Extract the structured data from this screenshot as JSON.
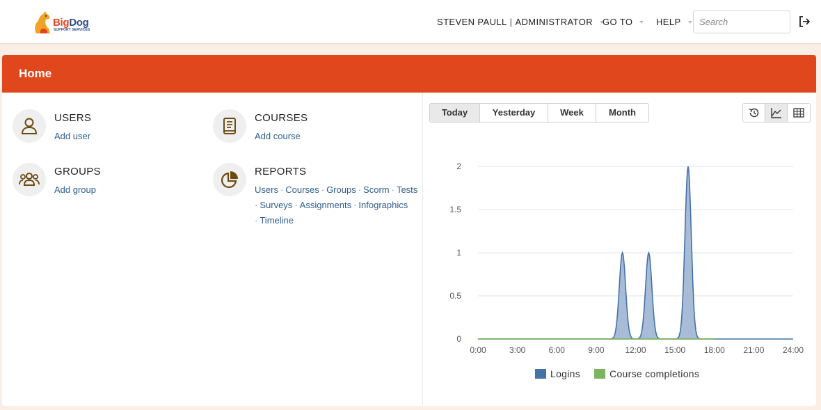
{
  "brand": {
    "name_part1": "Big",
    "name_part2": "Dog",
    "subtitle": "SUPPORT SERVICES"
  },
  "nav": {
    "user_name": "STEVEN PAULL",
    "separator": "|",
    "role": "ADMINISTRATOR",
    "goto_label": "GO TO",
    "help_label": "HELP",
    "search_placeholder": "Search"
  },
  "page": {
    "title": "Home"
  },
  "tiles": {
    "users": {
      "title": "USERS",
      "link": "Add user"
    },
    "courses": {
      "title": "COURSES",
      "link": "Add course"
    },
    "groups": {
      "title": "GROUPS",
      "link": "Add group"
    },
    "reports": {
      "title": "REPORTS",
      "links": [
        "Users",
        "Courses",
        "Groups",
        "Scorm",
        "Tests",
        "Surveys",
        "Assignments",
        "Infographics",
        "Timeline"
      ],
      "separator": "·"
    }
  },
  "range_tabs": [
    "Today",
    "Yesterday",
    "Week",
    "Month"
  ],
  "active_range": "Today",
  "colors": {
    "header": "#e1471c",
    "logins": "#4572a7",
    "logins_fill": "#a3b8d6",
    "completions": "#7cb462",
    "link": "#2d5d8e"
  },
  "chart_data": {
    "type": "area",
    "x_ticks": [
      "0:00",
      "3:00",
      "6:00",
      "9:00",
      "12:00",
      "15:00",
      "18:00",
      "21:00",
      "24:00"
    ],
    "y_ticks": [
      "0",
      "0.5",
      "1",
      "1.5",
      "2"
    ],
    "ylim": [
      0,
      2
    ],
    "xlim": [
      0,
      24
    ],
    "series": [
      {
        "name": "Logins",
        "peaks": [
          {
            "x": 11,
            "y": 1
          },
          {
            "x": 13,
            "y": 1
          },
          {
            "x": 16,
            "y": 2
          }
        ],
        "x_range": [
          0,
          24
        ]
      },
      {
        "name": "Course completions",
        "peaks": [],
        "x_range": [
          0,
          18
        ]
      }
    ],
    "legend": [
      "Logins",
      "Course completions"
    ],
    "legend_position": "bottom",
    "grid": true
  }
}
